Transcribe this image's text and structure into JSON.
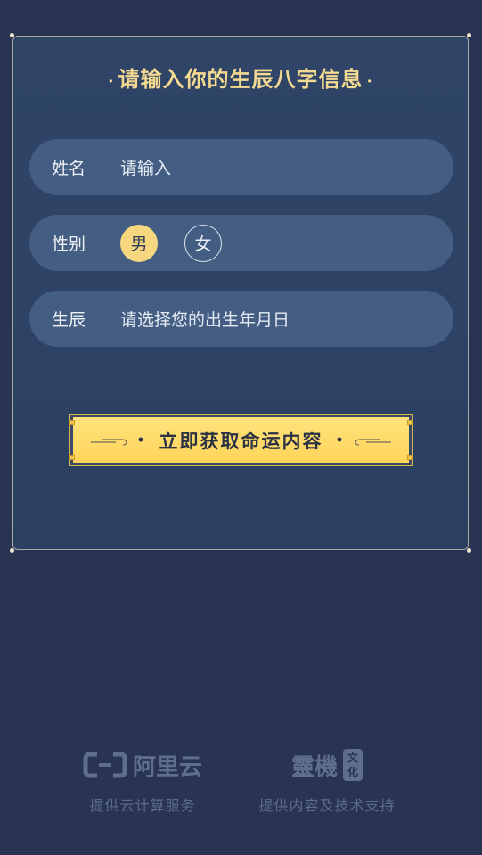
{
  "form": {
    "title": "请输入你的生辰八字信息",
    "title_sep": "·",
    "name": {
      "label": "姓名",
      "placeholder": "请输入"
    },
    "gender": {
      "label": "性别",
      "options": [
        "男",
        "女"
      ],
      "selected": "男"
    },
    "birth": {
      "label": "生辰",
      "placeholder": "请选择您的出生年月日"
    },
    "submit_label": "立即获取命运内容",
    "submit_dot": "•"
  },
  "footer": {
    "aliyun": {
      "logo_text": "阿里云",
      "caption": "提供云计算服务"
    },
    "lingji": {
      "logo_text": "靈機",
      "logo_badge_top": "文",
      "logo_badge_bottom": "化",
      "caption": "提供内容及技术支持"
    }
  },
  "colors": {
    "background": "#283452",
    "card": "#2f4466",
    "row": "#435d83",
    "accent_gold": "#f4d990",
    "selected": "#f6d77f",
    "button": "#ffd45a"
  },
  "icons": [
    "aliyun-logo-icon",
    "cloud-bracket-icon",
    "scroll-deco-icon"
  ]
}
